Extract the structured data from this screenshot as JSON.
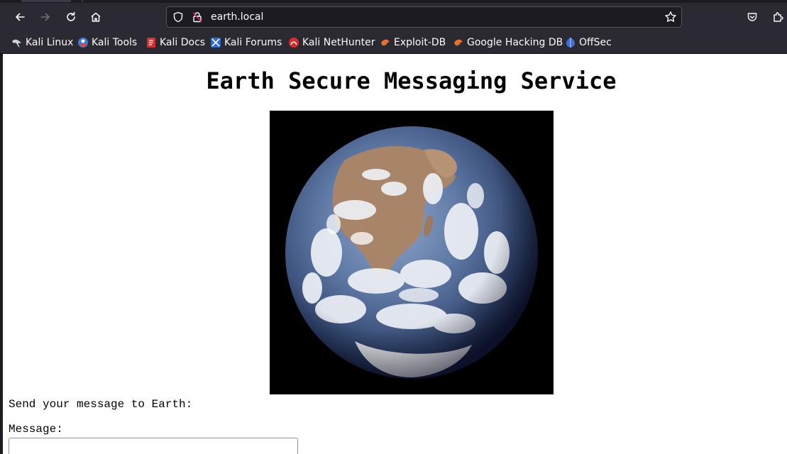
{
  "browser": {
    "address_bar": {
      "url": "earth.local"
    },
    "bookmarks": [
      {
        "label": "Kali Linux",
        "icon": "kali-dragon-icon"
      },
      {
        "label": "Kali Tools",
        "icon": "kali-tools-icon"
      },
      {
        "label": "Kali Docs",
        "icon": "kali-docs-icon"
      },
      {
        "label": "Kali Forums",
        "icon": "kali-forums-icon"
      },
      {
        "label": "Kali NetHunter",
        "icon": "kali-nethunter-icon"
      },
      {
        "label": "Exploit-DB",
        "icon": "exploit-db-icon"
      },
      {
        "label": "Google Hacking DB",
        "icon": "google-hacking-db-icon"
      },
      {
        "label": "OffSec",
        "icon": "offsec-icon"
      }
    ],
    "colors": {
      "chrome": "#2b2a33",
      "chrome_dark": "#1c1b22",
      "text": "#fbfbfe"
    }
  },
  "page": {
    "title": "Earth Secure Messaging Service",
    "image": {
      "icon": "earth-globe-image"
    },
    "prompt": "Send your message to Earth:",
    "message_label": "Message:",
    "message_value": ""
  }
}
